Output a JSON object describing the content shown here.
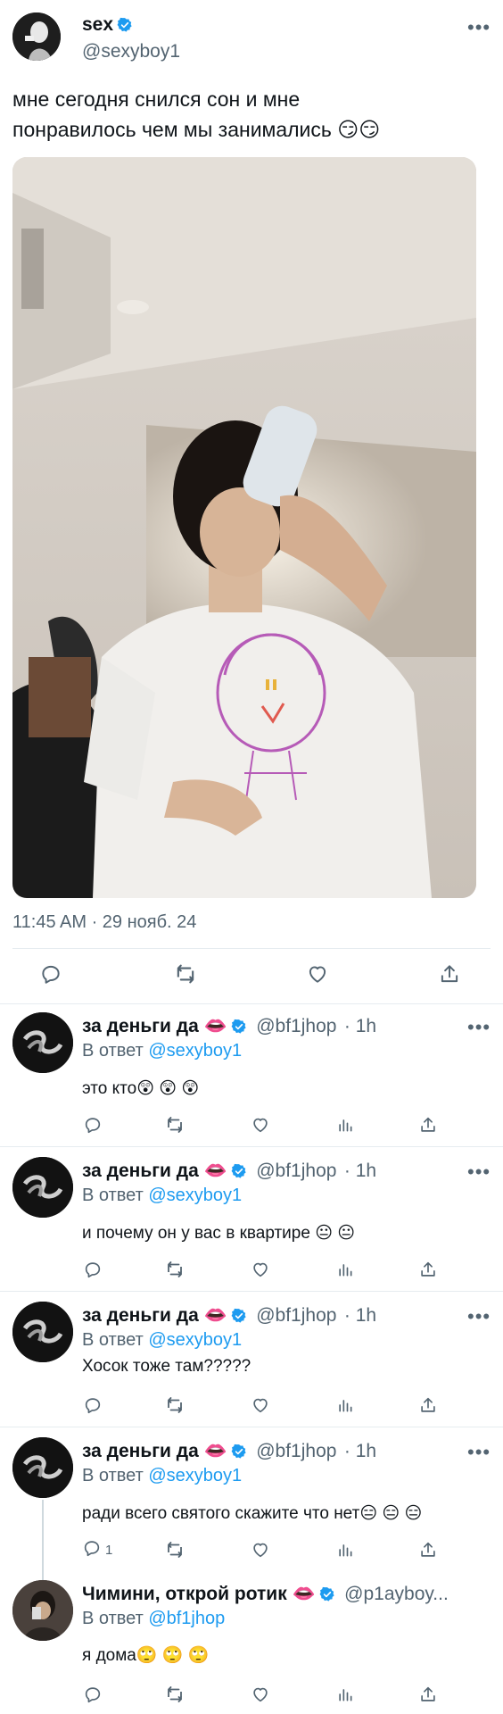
{
  "main_tweet": {
    "author_name": "sex",
    "author_handle": "@sexyboy1",
    "text_line1": "мне сегодня снился сон и мне",
    "text_line2": "понравилось чем мы занимались 😏😏",
    "timestamp": "11:45 AM · 29 нояб. 24"
  },
  "replies": [
    {
      "author_name": "за деньги да 👄",
      "author_handle": "@bf1jhop",
      "time": "· 1h",
      "reply_prefix": "В ответ",
      "reply_to": "@sexyboy1",
      "text": "это кто😲 😲 😲",
      "reply_count": ""
    },
    {
      "author_name": "за деньги да 👄",
      "author_handle": "@bf1jhop",
      "time": "· 1h",
      "reply_prefix": "В ответ",
      "reply_to": "@sexyboy1",
      "text": "и почему он у вас в квартире 😐 😐",
      "reply_count": ""
    },
    {
      "author_name": "за деньги да 👄",
      "author_handle": "@bf1jhop",
      "time": "· 1h",
      "reply_prefix": "В ответ",
      "reply_to": "@sexyboy1",
      "text": "Хосок тоже там?????",
      "reply_count": ""
    },
    {
      "author_name": "за деньги да 👄",
      "author_handle": "@bf1jhop",
      "time": "· 1h",
      "reply_prefix": "В ответ",
      "reply_to": "@sexyboy1",
      "text": "ради всего святого скажите что нет😑 😑 😑",
      "reply_count": "1"
    },
    {
      "author_name": "Чимини, открой ротик 👄",
      "author_handle": "@p1ayboy...",
      "time": "",
      "reply_prefix": "В ответ",
      "reply_to": "@bf1jhop",
      "text": "я дома🙄 🙄 🙄",
      "reply_count": ""
    }
  ],
  "colors": {
    "accent": "#1d9bf0",
    "muted": "#536471",
    "divider": "#e6ecf0"
  },
  "icons": [
    "verified-badge-icon",
    "more-options-icon",
    "reply-icon",
    "retweet-icon",
    "like-icon",
    "analytics-icon",
    "share-icon"
  ]
}
